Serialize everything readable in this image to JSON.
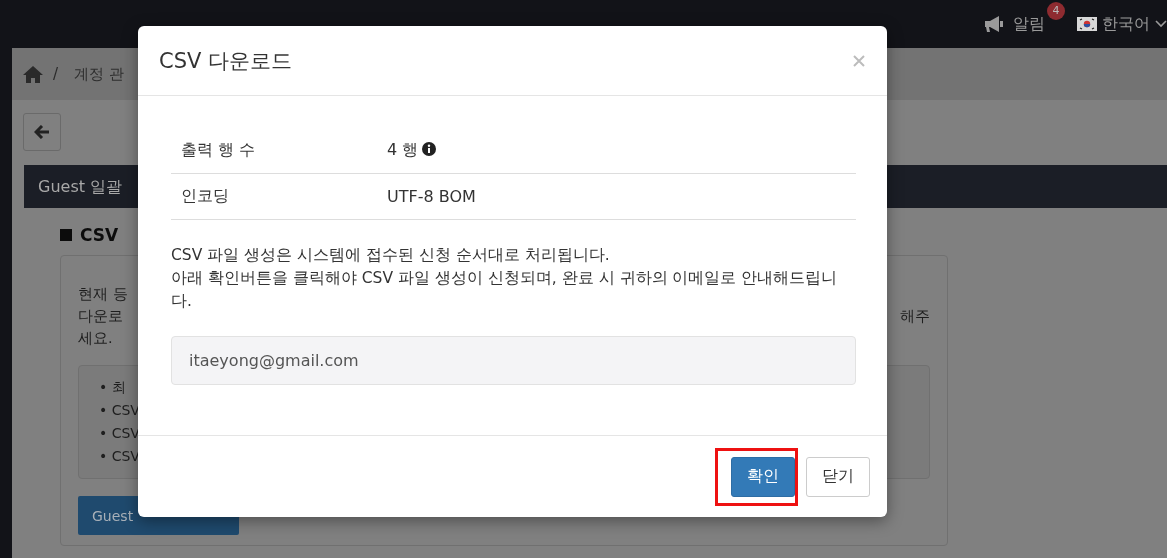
{
  "topbar": {
    "notifications": {
      "label": "알림",
      "count": "4"
    },
    "language": {
      "label": "한국어"
    }
  },
  "breadcrumb": {
    "separator": "/",
    "items": [
      "계정 관"
    ]
  },
  "panel": {
    "title": "Guest 일괄",
    "section_heading": "CSV",
    "description_lines": [
      "현재 등",
      "다운로",
      "세요."
    ],
    "description_right": "해주",
    "notes": [
      "• 최",
      "• CSV",
      "• CSV",
      "• CSV"
    ],
    "button": "Guest"
  },
  "modal": {
    "title": "CSV 다운로드",
    "rows": [
      {
        "label": "출력 행 수",
        "value": "4 행",
        "info": true
      },
      {
        "label": "인코딩",
        "value": "UTF-8 BOM",
        "info": false
      }
    ],
    "paragraph_lines": [
      "CSV 파일 생성은 시스템에 접수된 신청 순서대로 처리됩니다.",
      "아래 확인버튼을 클릭해야 CSV 파일 생성이 신청되며, 완료 시 귀하의 이메일로 안내해드립니다."
    ],
    "email": "itaeyong@gmail.com",
    "buttons": [
      {
        "label": "확인",
        "kind": "primary",
        "highlighted": true
      },
      {
        "label": "닫기",
        "kind": "default",
        "highlighted": false
      }
    ]
  }
}
